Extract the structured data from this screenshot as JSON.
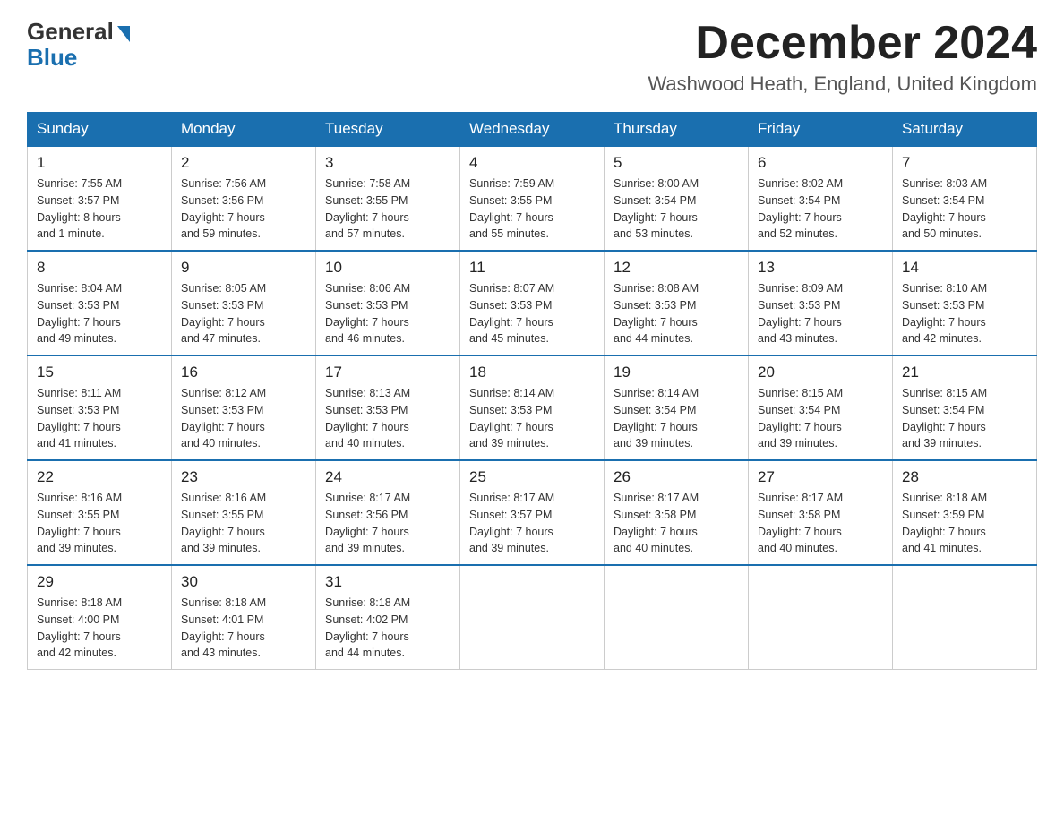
{
  "logo": {
    "general": "General",
    "blue": "Blue"
  },
  "title": "December 2024",
  "location": "Washwood Heath, England, United Kingdom",
  "days_of_week": [
    "Sunday",
    "Monday",
    "Tuesday",
    "Wednesday",
    "Thursday",
    "Friday",
    "Saturday"
  ],
  "weeks": [
    [
      {
        "day": "1",
        "sunrise": "7:55 AM",
        "sunset": "3:57 PM",
        "daylight": "8 hours and 1 minute."
      },
      {
        "day": "2",
        "sunrise": "7:56 AM",
        "sunset": "3:56 PM",
        "daylight": "7 hours and 59 minutes."
      },
      {
        "day": "3",
        "sunrise": "7:58 AM",
        "sunset": "3:55 PM",
        "daylight": "7 hours and 57 minutes."
      },
      {
        "day": "4",
        "sunrise": "7:59 AM",
        "sunset": "3:55 PM",
        "daylight": "7 hours and 55 minutes."
      },
      {
        "day": "5",
        "sunrise": "8:00 AM",
        "sunset": "3:54 PM",
        "daylight": "7 hours and 53 minutes."
      },
      {
        "day": "6",
        "sunrise": "8:02 AM",
        "sunset": "3:54 PM",
        "daylight": "7 hours and 52 minutes."
      },
      {
        "day": "7",
        "sunrise": "8:03 AM",
        "sunset": "3:54 PM",
        "daylight": "7 hours and 50 minutes."
      }
    ],
    [
      {
        "day": "8",
        "sunrise": "8:04 AM",
        "sunset": "3:53 PM",
        "daylight": "7 hours and 49 minutes."
      },
      {
        "day": "9",
        "sunrise": "8:05 AM",
        "sunset": "3:53 PM",
        "daylight": "7 hours and 47 minutes."
      },
      {
        "day": "10",
        "sunrise": "8:06 AM",
        "sunset": "3:53 PM",
        "daylight": "7 hours and 46 minutes."
      },
      {
        "day": "11",
        "sunrise": "8:07 AM",
        "sunset": "3:53 PM",
        "daylight": "7 hours and 45 minutes."
      },
      {
        "day": "12",
        "sunrise": "8:08 AM",
        "sunset": "3:53 PM",
        "daylight": "7 hours and 44 minutes."
      },
      {
        "day": "13",
        "sunrise": "8:09 AM",
        "sunset": "3:53 PM",
        "daylight": "7 hours and 43 minutes."
      },
      {
        "day": "14",
        "sunrise": "8:10 AM",
        "sunset": "3:53 PM",
        "daylight": "7 hours and 42 minutes."
      }
    ],
    [
      {
        "day": "15",
        "sunrise": "8:11 AM",
        "sunset": "3:53 PM",
        "daylight": "7 hours and 41 minutes."
      },
      {
        "day": "16",
        "sunrise": "8:12 AM",
        "sunset": "3:53 PM",
        "daylight": "7 hours and 40 minutes."
      },
      {
        "day": "17",
        "sunrise": "8:13 AM",
        "sunset": "3:53 PM",
        "daylight": "7 hours and 40 minutes."
      },
      {
        "day": "18",
        "sunrise": "8:14 AM",
        "sunset": "3:53 PM",
        "daylight": "7 hours and 39 minutes."
      },
      {
        "day": "19",
        "sunrise": "8:14 AM",
        "sunset": "3:54 PM",
        "daylight": "7 hours and 39 minutes."
      },
      {
        "day": "20",
        "sunrise": "8:15 AM",
        "sunset": "3:54 PM",
        "daylight": "7 hours and 39 minutes."
      },
      {
        "day": "21",
        "sunrise": "8:15 AM",
        "sunset": "3:54 PM",
        "daylight": "7 hours and 39 minutes."
      }
    ],
    [
      {
        "day": "22",
        "sunrise": "8:16 AM",
        "sunset": "3:55 PM",
        "daylight": "7 hours and 39 minutes."
      },
      {
        "day": "23",
        "sunrise": "8:16 AM",
        "sunset": "3:55 PM",
        "daylight": "7 hours and 39 minutes."
      },
      {
        "day": "24",
        "sunrise": "8:17 AM",
        "sunset": "3:56 PM",
        "daylight": "7 hours and 39 minutes."
      },
      {
        "day": "25",
        "sunrise": "8:17 AM",
        "sunset": "3:57 PM",
        "daylight": "7 hours and 39 minutes."
      },
      {
        "day": "26",
        "sunrise": "8:17 AM",
        "sunset": "3:58 PM",
        "daylight": "7 hours and 40 minutes."
      },
      {
        "day": "27",
        "sunrise": "8:17 AM",
        "sunset": "3:58 PM",
        "daylight": "7 hours and 40 minutes."
      },
      {
        "day": "28",
        "sunrise": "8:18 AM",
        "sunset": "3:59 PM",
        "daylight": "7 hours and 41 minutes."
      }
    ],
    [
      {
        "day": "29",
        "sunrise": "8:18 AM",
        "sunset": "4:00 PM",
        "daylight": "7 hours and 42 minutes."
      },
      {
        "day": "30",
        "sunrise": "8:18 AM",
        "sunset": "4:01 PM",
        "daylight": "7 hours and 43 minutes."
      },
      {
        "day": "31",
        "sunrise": "8:18 AM",
        "sunset": "4:02 PM",
        "daylight": "7 hours and 44 minutes."
      },
      null,
      null,
      null,
      null
    ]
  ],
  "labels": {
    "sunrise": "Sunrise:",
    "sunset": "Sunset:",
    "daylight": "Daylight:"
  }
}
